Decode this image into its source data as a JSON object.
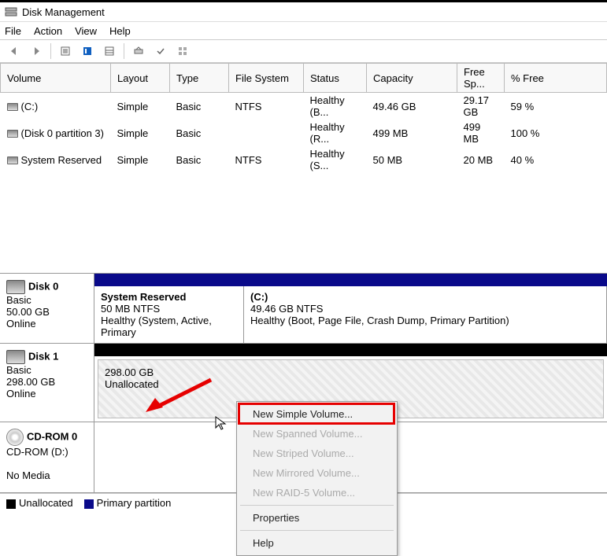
{
  "title": "Disk Management",
  "menu": {
    "file": "File",
    "action": "Action",
    "view": "View",
    "help": "Help"
  },
  "columns": {
    "volume": "Volume",
    "layout": "Layout",
    "type": "Type",
    "fs": "File System",
    "status": "Status",
    "capacity": "Capacity",
    "free": "Free Sp...",
    "pct": "% Free"
  },
  "volumes": [
    {
      "name": "(C:)",
      "layout": "Simple",
      "type": "Basic",
      "fs": "NTFS",
      "status": "Healthy (B...",
      "capacity": "49.46 GB",
      "free": "29.17 GB",
      "pct": "59 %"
    },
    {
      "name": "(Disk 0 partition 3)",
      "layout": "Simple",
      "type": "Basic",
      "fs": "",
      "status": "Healthy (R...",
      "capacity": "499 MB",
      "free": "499 MB",
      "pct": "100 %"
    },
    {
      "name": "System Reserved",
      "layout": "Simple",
      "type": "Basic",
      "fs": "NTFS",
      "status": "Healthy (S...",
      "capacity": "50 MB",
      "free": "20 MB",
      "pct": "40 %"
    }
  ],
  "disk0": {
    "name": "Disk 0",
    "type": "Basic",
    "size": "50.00 GB",
    "state": "Online",
    "sysres": {
      "title": "System Reserved",
      "sub": "50 MB NTFS",
      "status": "Healthy (System, Active, Primary"
    },
    "c": {
      "title": "(C:)",
      "sub": "49.46 GB NTFS",
      "status": "Healthy (Boot, Page File, Crash Dump, Primary Partition)"
    }
  },
  "disk1": {
    "name": "Disk 1",
    "type": "Basic",
    "size": "298.00 GB",
    "state": "Online",
    "unalloc_size": "298.00 GB",
    "unalloc_label": "Unallocated"
  },
  "cdrom": {
    "name": "CD-ROM 0",
    "drive": "CD-ROM (D:)",
    "state": "No Media"
  },
  "legend": {
    "unalloc": "Unallocated",
    "primary": "Primary partition"
  },
  "context": {
    "new_simple": "New Simple Volume...",
    "new_spanned": "New Spanned Volume...",
    "new_striped": "New Striped Volume...",
    "new_mirrored": "New Mirrored Volume...",
    "new_raid5": "New RAID-5 Volume...",
    "properties": "Properties",
    "help": "Help"
  }
}
